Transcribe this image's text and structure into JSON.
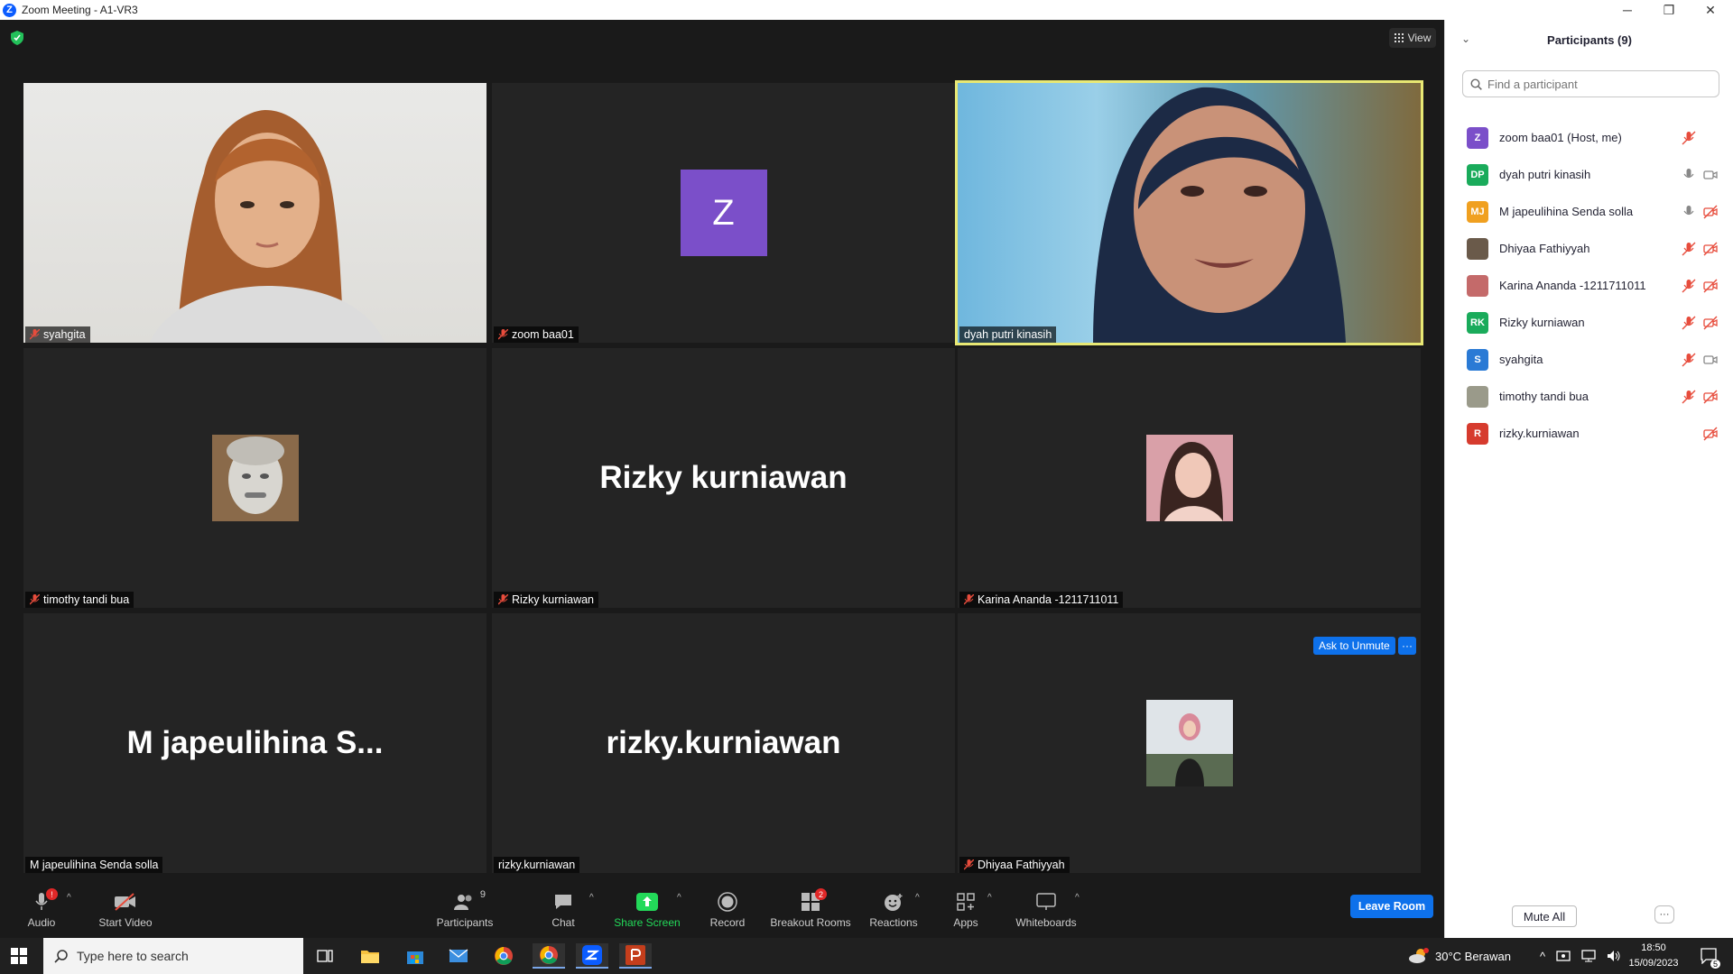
{
  "window": {
    "title": "Zoom Meeting - A1-VR3",
    "app_letter": "Z"
  },
  "meeting": {
    "view_label": "View",
    "ask_to_unmute": "Ask to Unmute",
    "more": "···",
    "tiles": [
      {
        "name": "syahgita",
        "mic_off": true,
        "display": "video"
      },
      {
        "name": "zoom baa01",
        "mic_off": true,
        "display": "letter",
        "letter": "Z"
      },
      {
        "name": "dyah putri kinasih",
        "mic_off": false,
        "display": "video",
        "active_speaker": true
      },
      {
        "name": "timothy tandi bua",
        "mic_off": true,
        "display": "photo"
      },
      {
        "name": "Rizky kurniawan",
        "mic_off": true,
        "display": "text",
        "big": "Rizky kurniawan"
      },
      {
        "name": "Karina Ananda -1211711011",
        "mic_off": true,
        "display": "photo"
      },
      {
        "name": "M japeulihina Senda solla",
        "mic_off": false,
        "display": "text",
        "big": "M japeulihina S..."
      },
      {
        "name": "rizky.kurniawan",
        "mic_off": false,
        "display": "text",
        "big": "rizky.kurniawan"
      },
      {
        "name": "Dhiyaa Fathiyyah",
        "mic_off": true,
        "display": "photo"
      }
    ]
  },
  "toolbar": {
    "audio": "Audio",
    "audio_badge": "!",
    "start_video": "Start Video",
    "participants": "Participants",
    "participants_count": "9",
    "chat": "Chat",
    "share_screen": "Share Screen",
    "record": "Record",
    "breakout_rooms": "Breakout Rooms",
    "breakout_badge": "2",
    "reactions": "Reactions",
    "apps": "Apps",
    "whiteboards": "Whiteboards",
    "leave_room": "Leave Room",
    "share_color": "#23d959",
    "leave_color": "#0e71eb"
  },
  "participants_panel": {
    "title": "Participants (9)",
    "search_placeholder": "Find a participant",
    "mute_all": "Mute All",
    "more": "···",
    "items": [
      {
        "initials": "Z",
        "name": "zoom baa01 (Host, me)",
        "color": "#7b4fc9",
        "mic": "muted",
        "video": "none"
      },
      {
        "initials": "DP",
        "name": "dyah putri kinasih",
        "color": "#1aab5b",
        "mic": "on",
        "video": "on"
      },
      {
        "initials": "MJ",
        "name": "M japeulihina Senda solla",
        "color": "#f0a020",
        "mic": "on",
        "video": "off"
      },
      {
        "initials": "",
        "name": "Dhiyaa Fathiyyah",
        "color": "#6a5a4a",
        "mic": "muted",
        "video": "off"
      },
      {
        "initials": "",
        "name": "Karina Ananda -1211711011",
        "color": "#c46a6a",
        "mic": "muted",
        "video": "off"
      },
      {
        "initials": "RK",
        "name": "Rizky kurniawan",
        "color": "#1aab5b",
        "mic": "muted",
        "video": "off"
      },
      {
        "initials": "S",
        "name": "syahgita",
        "color": "#2a7ad5",
        "mic": "muted",
        "video": "on"
      },
      {
        "initials": "",
        "name": "timothy tandi bua",
        "color": "#9a9a8a",
        "mic": "muted",
        "video": "off"
      },
      {
        "initials": "R",
        "name": "rizky.kurniawan",
        "color": "#d63b2e",
        "mic": "none",
        "video": "off"
      }
    ]
  },
  "taskbar": {
    "search_placeholder": "Type here to search",
    "weather": "30°C  Berawan",
    "time": "18:50",
    "date": "15/09/2023",
    "notification_count": "5"
  }
}
